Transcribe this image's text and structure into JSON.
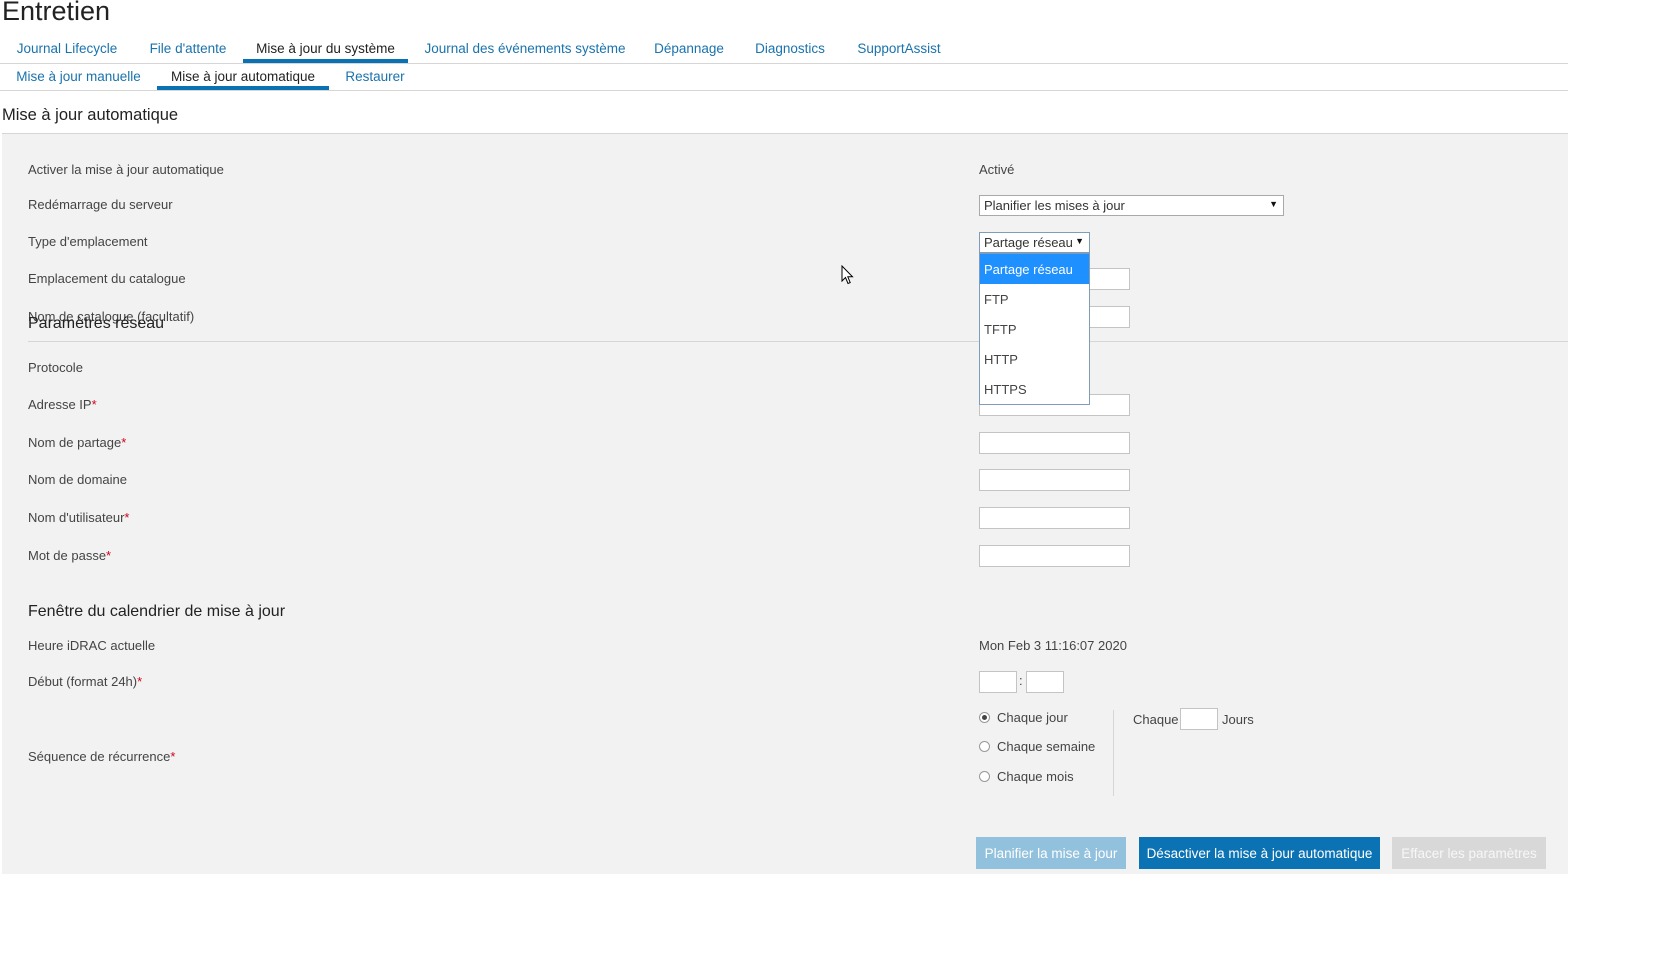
{
  "page": {
    "title": "Entretien"
  },
  "tabs": [
    {
      "label": "Journal Lifecycle"
    },
    {
      "label": "File d'attente"
    },
    {
      "label": "Mise à jour du système"
    },
    {
      "label": "Journal des événements système"
    },
    {
      "label": "Dépannage"
    },
    {
      "label": "Diagnostics"
    },
    {
      "label": "SupportAssist"
    }
  ],
  "subtabs": [
    {
      "label": "Mise à jour manuelle"
    },
    {
      "label": "Mise à jour automatique"
    },
    {
      "label": "Restaurer"
    }
  ],
  "section": {
    "title": "Mise à jour automatique"
  },
  "form": {
    "enable_label": "Activer la mise à jour automatique",
    "enable_value": "Activé",
    "reboot_label": "Redémarrage du serveur",
    "reboot_value": "Planifier les mises à jour",
    "location_type_label": "Type d'emplacement",
    "location_type_value": "Partage réseau",
    "location_type_options": [
      "Partage réseau",
      "FTP",
      "TFTP",
      "HTTP",
      "HTTPS"
    ],
    "catalog_location_label": "Emplacement du catalogue",
    "catalog_name_label": "Nom de catalogue (facultatif)"
  },
  "network": {
    "heading": "Paramètres réseau",
    "protocol_label": "Protocole",
    "ip_label": "Adresse IP",
    "share_label": "Nom de partage",
    "domain_label": "Nom de domaine",
    "user_label": "Nom d'utilisateur",
    "password_label": "Mot de passe",
    "required_mark": "*"
  },
  "schedule": {
    "heading": "Fenêtre du calendrier de mise à jour",
    "current_time_label": "Heure iDRAC actuelle",
    "current_time_value": "Mon Feb 3 11:16:07 2020",
    "start_label": "Début (format 24h)",
    "time_separator": ":",
    "recurrence_label": "Séquence de récurrence",
    "options": [
      "Chaque jour",
      "Chaque semaine",
      "Chaque mois"
    ],
    "every_prefix": "Chaque",
    "every_suffix": "Jours"
  },
  "buttons": {
    "schedule": "Planifier la mise à jour",
    "disable": "Désactiver la mise à jour automatique",
    "clear": "Effacer les paramètres"
  }
}
